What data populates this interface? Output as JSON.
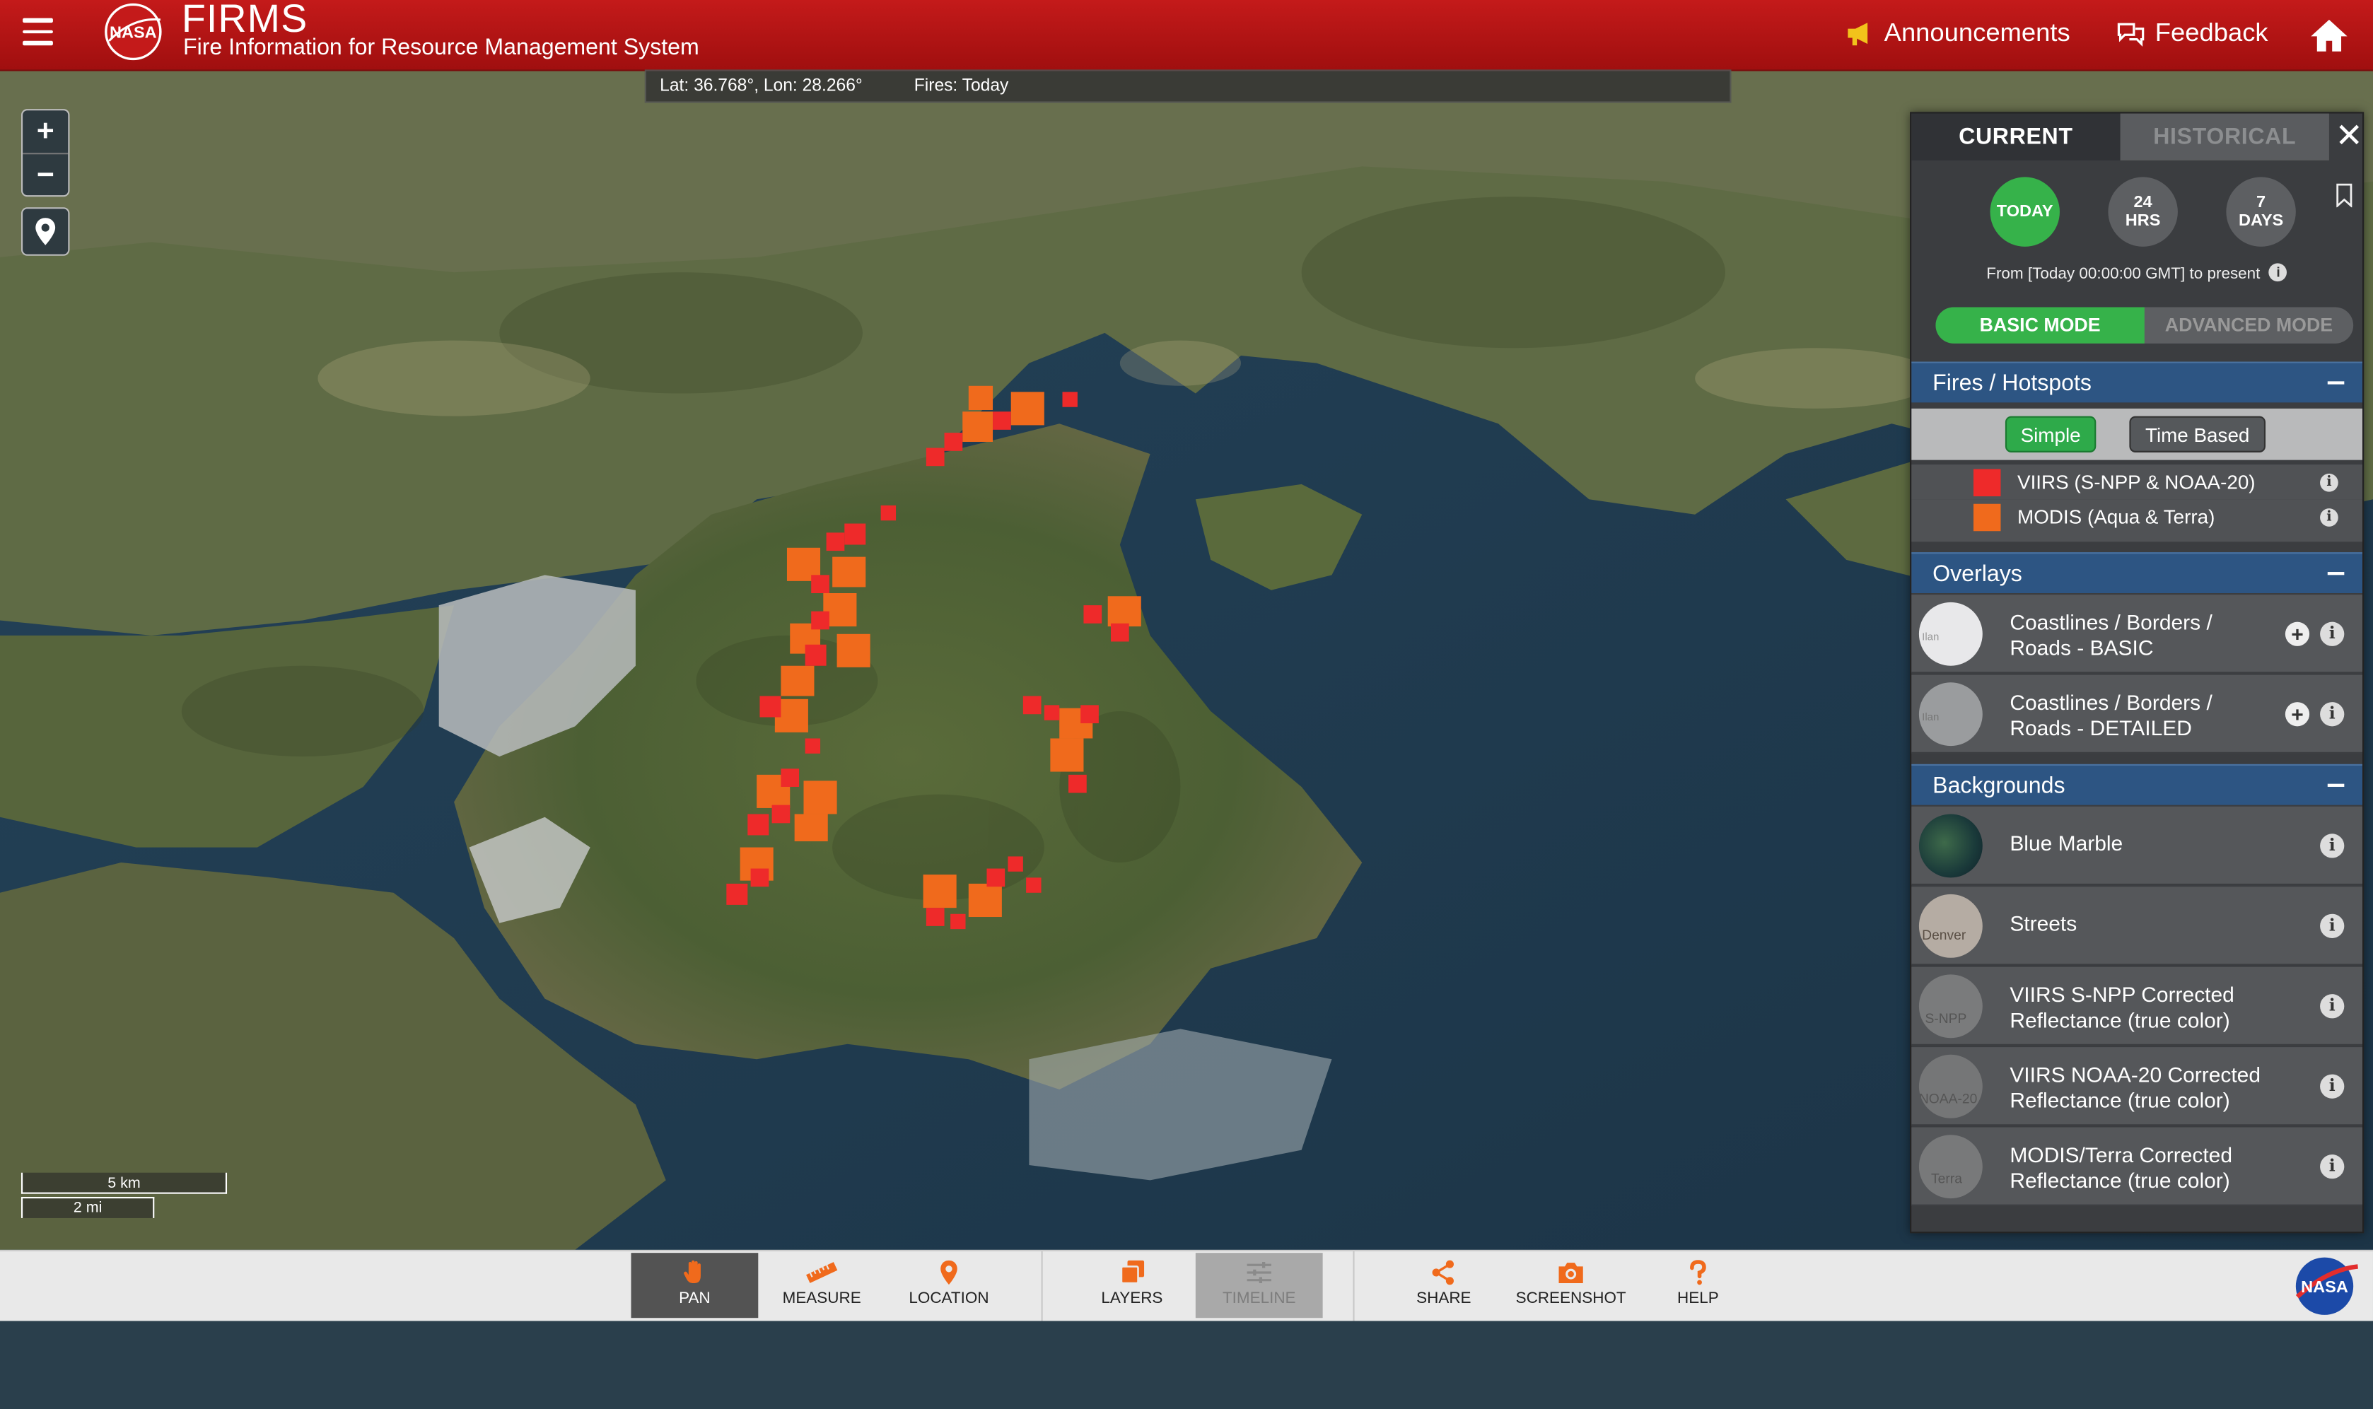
{
  "header": {
    "app_title": "FIRMS",
    "app_subtitle": "Fire Information for Resource Management System",
    "announcements_label": "Announcements",
    "feedback_label": "Feedback",
    "logo_text": "NASA"
  },
  "info_bar": {
    "coords": "Lat: 36.768°, Lon: 28.266°",
    "fires": "Fires: Today"
  },
  "map": {
    "scale_km": "5 km",
    "scale_mi": "2 mi",
    "zoom_in": "+",
    "zoom_out": "−"
  },
  "panel": {
    "tabs": {
      "current": "CURRENT",
      "historical": "HISTORICAL"
    },
    "time_buttons": {
      "today": "TODAY",
      "hrs24_a": "24",
      "hrs24_b": "HRS",
      "days7_a": "7",
      "days7_b": "DAYS"
    },
    "date_range": "From [Today 00:00:00 GMT] to present",
    "mode": {
      "basic": "BASIC MODE",
      "advanced": "ADVANCED MODE"
    },
    "fires_section": {
      "title": "Fires / Hotspots",
      "simple": "Simple",
      "time_based": "Time Based",
      "legend": [
        {
          "label": "VIIRS (S-NPP & NOAA-20)",
          "color": "#ee2a2a"
        },
        {
          "label": "MODIS (Aqua & Terra)",
          "color": "#f06a1c"
        }
      ]
    },
    "overlays_section": {
      "title": "Overlays",
      "items": [
        {
          "line1": "Coastlines / Borders /",
          "line2": "Roads - BASIC",
          "thumb_text": "Ilan"
        },
        {
          "line1": "Coastlines / Borders /",
          "line2": "Roads - DETAILED",
          "thumb_text": "Ilan"
        }
      ]
    },
    "backgrounds_section": {
      "title": "Backgrounds",
      "items": [
        {
          "line1": "Blue Marble",
          "line2": "",
          "thumb_text": ""
        },
        {
          "line1": "Streets",
          "line2": "",
          "thumb_text": "Denver"
        },
        {
          "line1": "VIIRS S-NPP Corrected",
          "line2": "Reflectance (true color)",
          "thumb_text": "S-NPP"
        },
        {
          "line1": "VIIRS NOAA-20 Corrected",
          "line2": "Reflectance (true color)",
          "thumb_text": "NOAA-20"
        },
        {
          "line1": "MODIS/Terra Corrected",
          "line2": "Reflectance (true color)",
          "thumb_text": "Terra"
        }
      ]
    }
  },
  "toolbar": {
    "pan": "PAN",
    "measure": "MEASURE",
    "location": "LOCATION",
    "layers": "LAYERS",
    "timeline": "TIMELINE",
    "share": "SHARE",
    "screenshot": "SCREENSHOT",
    "help": "HELP"
  },
  "colors": {
    "header_red": "#b81515",
    "accent_orange": "#f06a1c",
    "active_green": "#36b24a",
    "section_blue": "#2d5583"
  }
}
